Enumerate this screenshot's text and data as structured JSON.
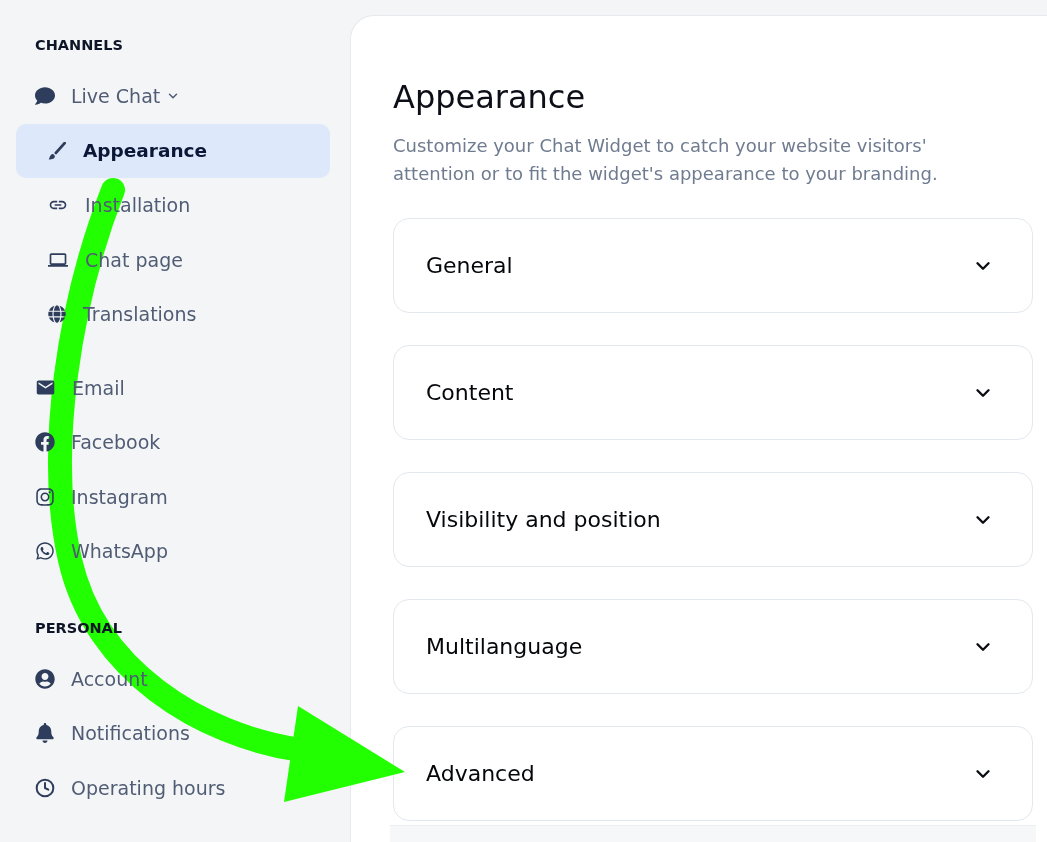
{
  "sidebar": {
    "sections": [
      {
        "heading": "CHANNELS",
        "items": [
          {
            "label": "Live Chat",
            "selected": false,
            "expanded": true,
            "children": [
              {
                "label": "Appearance",
                "selected": true
              },
              {
                "label": "Installation",
                "selected": false
              },
              {
                "label": "Chat page",
                "selected": false
              },
              {
                "label": "Translations",
                "selected": false
              }
            ]
          },
          {
            "label": "Email",
            "selected": false
          },
          {
            "label": "Facebook",
            "selected": false
          },
          {
            "label": "Instagram",
            "selected": false
          },
          {
            "label": "WhatsApp",
            "selected": false
          }
        ]
      },
      {
        "heading": "PERSONAL",
        "items": [
          {
            "label": "Account",
            "selected": false
          },
          {
            "label": "Notifications",
            "selected": false
          },
          {
            "label": "Operating hours",
            "selected": false
          }
        ]
      }
    ]
  },
  "main": {
    "title": "Appearance",
    "description": "Customize your Chat Widget to catch your website visitors' attention or to fit the widget's appearance to your branding.",
    "sections": [
      {
        "title": "General",
        "expanded": false
      },
      {
        "title": "Content",
        "expanded": false
      },
      {
        "title": "Visibility and position",
        "expanded": false
      },
      {
        "title": "Multilanguage",
        "expanded": false
      },
      {
        "title": "Advanced",
        "expanded": false
      }
    ]
  },
  "annotations": [
    {
      "kind": "arrow"
    }
  ]
}
